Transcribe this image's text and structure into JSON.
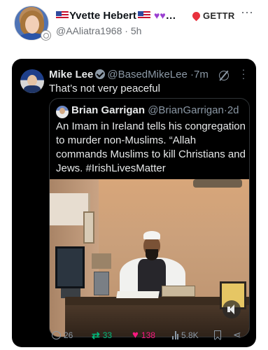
{
  "post": {
    "author_name": "Yvette Hebert",
    "author_suffix": "…",
    "author_handle": "@AAliatra1968",
    "separator": "·",
    "time": "5h",
    "platform": "GETTR",
    "more_glyph": "⋯"
  },
  "embed": {
    "author_name": "Mike Lee",
    "author_handle": "@BasedMikeLee",
    "separator": "·",
    "time": "7m",
    "text": "That’s not very peaceful",
    "quote": {
      "author_name": "Brian Garrigan",
      "author_handle": "@BrianGarrigan",
      "separator": "·",
      "time": "2d",
      "text": "An Imam in Ireland tells his congregation to murder non-Muslims. “Allah commands Muslims to kill Christians and Jews. #IrishLivesMatter"
    },
    "actions": {
      "replies": "26",
      "retweets": "33",
      "likes": "138",
      "views": "5.8K"
    }
  },
  "colors": {
    "like": "#f91880",
    "retweet": "#00ba7c",
    "gettr": "#e8313d"
  }
}
